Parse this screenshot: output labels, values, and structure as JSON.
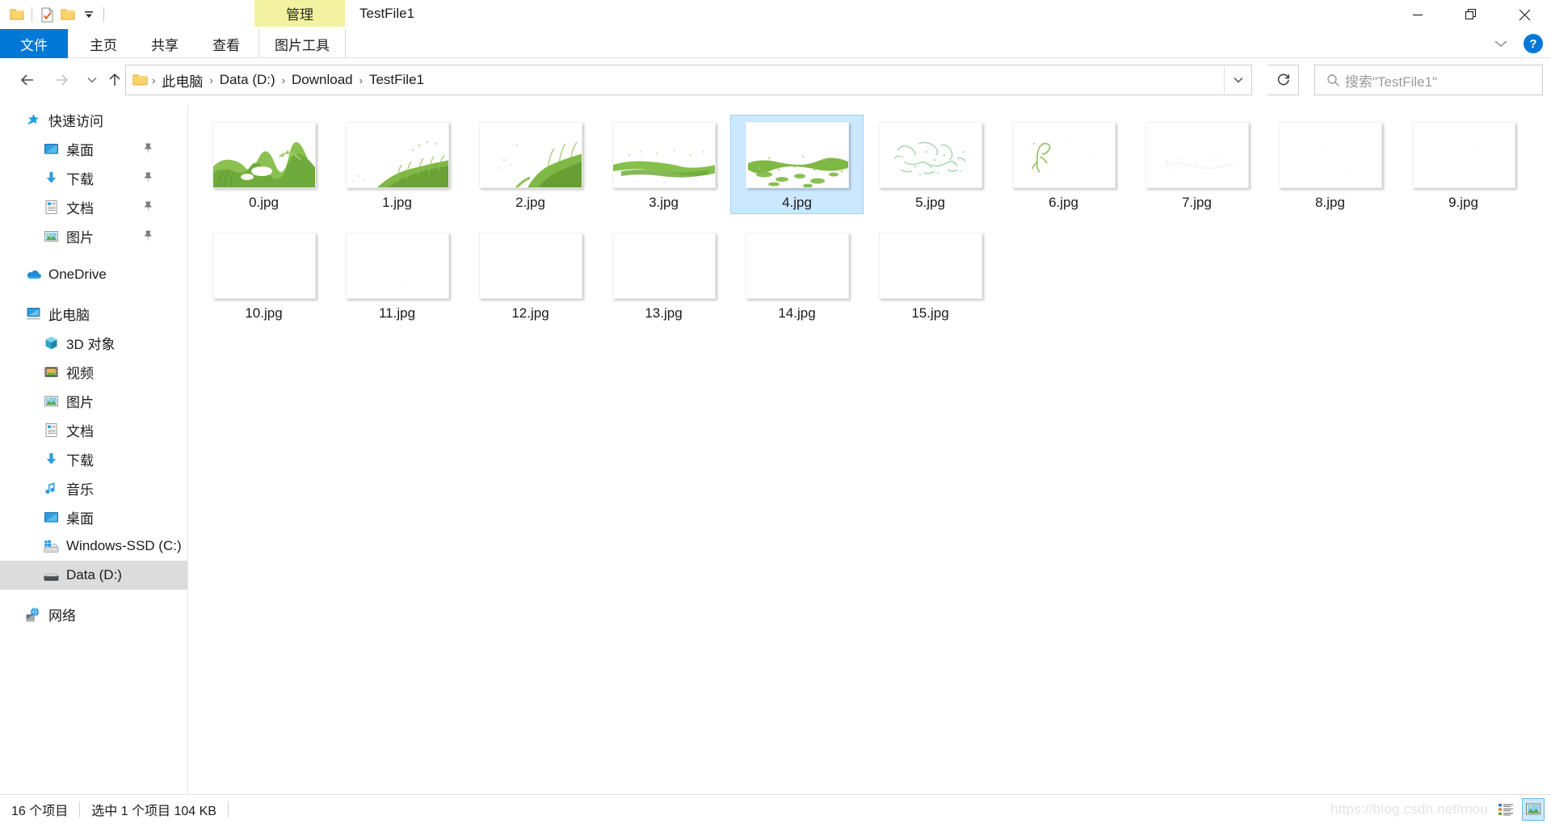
{
  "window": {
    "title": "TestFile1",
    "contextual_tab": "管理",
    "controls": {
      "minimize": "minimize-icon",
      "maximize": "maximize-icon",
      "close": "close-icon"
    },
    "quick_access_toolbar": [
      {
        "name": "folder-icon",
        "label": ""
      },
      {
        "name": "properties-icon",
        "label": ""
      },
      {
        "name": "new-folder-icon",
        "label": ""
      },
      {
        "name": "customize-chevron-icon",
        "label": ""
      }
    ]
  },
  "ribbon": {
    "tabs": [
      {
        "id": "file",
        "label": "文件",
        "active": false,
        "style": "file"
      },
      {
        "id": "home",
        "label": "主页",
        "active": false,
        "style": "normal"
      },
      {
        "id": "share",
        "label": "共享",
        "active": false,
        "style": "normal"
      },
      {
        "id": "view",
        "label": "查看",
        "active": false,
        "style": "normal"
      },
      {
        "id": "pictools",
        "label": "图片工具",
        "active": true,
        "style": "pictools"
      }
    ],
    "collapse_icon": "chevron-down-icon",
    "help_label": "?"
  },
  "navigation": {
    "back_icon": "arrow-left-icon",
    "forward_icon": "arrow-right-icon",
    "recent_icon": "chevron-down-icon",
    "up_icon": "arrow-up-icon",
    "breadcrumb": [
      "此电脑",
      "Data (D:)",
      "Download",
      "TestFile1"
    ],
    "breadcrumb_separator": "›",
    "address_chevron": "chevron-down-icon",
    "refresh_icon": "refresh-icon"
  },
  "search": {
    "icon": "search-icon",
    "placeholder": "搜索\"TestFile1\""
  },
  "sidebar": {
    "groups": [
      {
        "header": {
          "label": "快速访问",
          "icon": "star-pin-icon",
          "indent": 0
        },
        "items": [
          {
            "label": "桌面",
            "icon": "desktop-icon",
            "pinned": true,
            "indent": 1
          },
          {
            "label": "下载",
            "icon": "download-icon",
            "pinned": true,
            "indent": 1
          },
          {
            "label": "文档",
            "icon": "documents-icon",
            "pinned": true,
            "indent": 1
          },
          {
            "label": "图片",
            "icon": "pictures-icon",
            "pinned": true,
            "indent": 1
          }
        ]
      },
      {
        "header": {
          "label": "OneDrive",
          "icon": "onedrive-icon",
          "indent": 0
        },
        "items": []
      },
      {
        "header": {
          "label": "此电脑",
          "icon": "this-pc-icon",
          "indent": 0
        },
        "items": [
          {
            "label": "3D 对象",
            "icon": "3d-objects-icon",
            "pinned": false,
            "indent": 1
          },
          {
            "label": "视频",
            "icon": "videos-icon",
            "pinned": false,
            "indent": 1
          },
          {
            "label": "图片",
            "icon": "pictures-icon",
            "pinned": false,
            "indent": 1
          },
          {
            "label": "文档",
            "icon": "documents-icon",
            "pinned": false,
            "indent": 1
          },
          {
            "label": "下载",
            "icon": "download-icon",
            "pinned": false,
            "indent": 1
          },
          {
            "label": "音乐",
            "icon": "music-icon",
            "pinned": false,
            "indent": 1
          },
          {
            "label": "桌面",
            "icon": "desktop-icon",
            "pinned": false,
            "indent": 1
          },
          {
            "label": "Windows-SSD (C:)",
            "icon": "windows-drive-icon",
            "pinned": false,
            "indent": 1
          },
          {
            "label": "Data (D:)",
            "icon": "drive-icon",
            "pinned": false,
            "indent": 1,
            "selected": true
          }
        ]
      },
      {
        "header": {
          "label": "网络",
          "icon": "network-icon",
          "indent": 0
        },
        "items": []
      }
    ]
  },
  "files": [
    {
      "name": "0.jpg",
      "selected": false,
      "thumb": "grass-dense-white"
    },
    {
      "name": "1.jpg",
      "selected": false,
      "thumb": "grass-right-slope"
    },
    {
      "name": "2.jpg",
      "selected": false,
      "thumb": "grass-right-heavy"
    },
    {
      "name": "3.jpg",
      "selected": false,
      "thumb": "grass-thin-band"
    },
    {
      "name": "4.jpg",
      "selected": true,
      "thumb": "grass-speckled"
    },
    {
      "name": "5.jpg",
      "selected": false,
      "thumb": "sparse-pale-marks"
    },
    {
      "name": "6.jpg",
      "selected": false,
      "thumb": "single-sprout"
    },
    {
      "name": "7.jpg",
      "selected": false,
      "thumb": "near-blank-faint"
    },
    {
      "name": "8.jpg",
      "selected": false,
      "thumb": "blank"
    },
    {
      "name": "9.jpg",
      "selected": false,
      "thumb": "blank"
    },
    {
      "name": "10.jpg",
      "selected": false,
      "thumb": "blank"
    },
    {
      "name": "11.jpg",
      "selected": false,
      "thumb": "blank"
    },
    {
      "name": "12.jpg",
      "selected": false,
      "thumb": "blank"
    },
    {
      "name": "13.jpg",
      "selected": false,
      "thumb": "blank"
    },
    {
      "name": "14.jpg",
      "selected": false,
      "thumb": "blank"
    },
    {
      "name": "15.jpg",
      "selected": false,
      "thumb": "blank"
    }
  ],
  "statusbar": {
    "item_count": "16 个项目",
    "selection": "选中 1 个项目  104 KB",
    "views": [
      {
        "name": "details-view-button",
        "icon": "details-view-icon",
        "active": false
      },
      {
        "name": "large-icons-view-button",
        "icon": "large-icons-view-icon",
        "active": true
      }
    ]
  },
  "watermark": "https://blog.csdn.net/mou",
  "colors": {
    "accent": "#0078d7",
    "contextual_tab": "#f2f2a0",
    "selection_fill": "#cce8ff",
    "selection_border": "#99d1ff",
    "sidebar_selected": "#dcdcdc",
    "thumb_green": "#7ab648"
  }
}
